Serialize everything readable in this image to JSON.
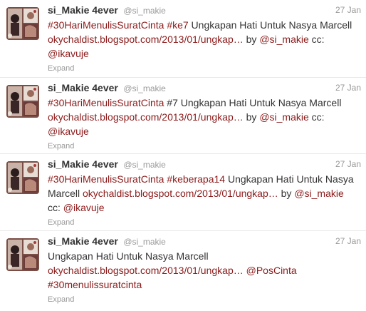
{
  "colors": {
    "link": "#8b1a1a",
    "muted": "#999999",
    "text": "#333333",
    "divider": "#e8e8e8"
  },
  "tweets": [
    {
      "avatar_icon": "profile-photo-icon",
      "fullname": "si_Makie 4ever",
      "username": "@si_makie",
      "time": "27 Jan",
      "lines": [
        [
          {
            "text": "#30HariMenulisSuratCinta",
            "link": true
          },
          {
            "text": " ",
            "link": false
          },
          {
            "text": "#ke7",
            "link": true
          },
          {
            "text": " Ungkapan Hati Untuk Nasya Marcell",
            "link": false
          }
        ],
        [
          {
            "text": "okychaldist.blogspot.com/2013/01/ungkap…",
            "link": true
          },
          {
            "text": " by ",
            "link": false
          },
          {
            "text": "@si_makie",
            "link": true
          },
          {
            "text": " cc:",
            "link": false
          }
        ],
        [
          {
            "text": "@ikavuje",
            "link": true
          }
        ]
      ],
      "expand": "Expand"
    },
    {
      "avatar_icon": "profile-photo-icon",
      "fullname": "si_Makie 4ever",
      "username": "@si_makie",
      "time": "27 Jan",
      "lines": [
        [
          {
            "text": "#30HariMenulisSuratCinta",
            "link": true
          },
          {
            "text": " #7 Ungkapan Hati Untuk Nasya Marcell",
            "link": false
          }
        ],
        [
          {
            "text": "okychaldist.blogspot.com/2013/01/ungkap…",
            "link": true
          },
          {
            "text": " by ",
            "link": false
          },
          {
            "text": "@si_makie",
            "link": true
          },
          {
            "text": " cc:",
            "link": false
          }
        ],
        [
          {
            "text": "@ikavuje",
            "link": true
          }
        ]
      ],
      "expand": "Expand"
    },
    {
      "avatar_icon": "profile-photo-icon",
      "fullname": "si_Makie 4ever",
      "username": "@si_makie",
      "time": "27 Jan",
      "lines": [
        [
          {
            "text": "#30HariMenulisSuratCinta",
            "link": true
          },
          {
            "text": " ",
            "link": false
          },
          {
            "text": "#keberapa14",
            "link": true
          },
          {
            "text": " Ungkapan Hati Untuk Nasya",
            "link": false
          }
        ],
        [
          {
            "text": "Marcell ",
            "link": false
          },
          {
            "text": "okychaldist.blogspot.com/2013/01/ungkap…",
            "link": true
          },
          {
            "text": " by ",
            "link": false
          },
          {
            "text": "@si_makie",
            "link": true
          }
        ],
        [
          {
            "text": "cc: ",
            "link": false
          },
          {
            "text": "@ikavuje",
            "link": true
          }
        ]
      ],
      "expand": "Expand"
    },
    {
      "avatar_icon": "profile-photo-icon",
      "fullname": "si_Makie 4ever",
      "username": "@si_makie",
      "time": "27 Jan",
      "lines": [
        [
          {
            "text": "Ungkapan Hati Untuk Nasya Marcell",
            "link": false
          }
        ],
        [
          {
            "text": "okychaldist.blogspot.com/2013/01/ungkap…",
            "link": true
          },
          {
            "text": " ",
            "link": false
          },
          {
            "text": "@PosCinta",
            "link": true
          }
        ],
        [
          {
            "text": "#30menulissuratcinta",
            "link": true
          }
        ]
      ],
      "expand": "Expand"
    }
  ]
}
